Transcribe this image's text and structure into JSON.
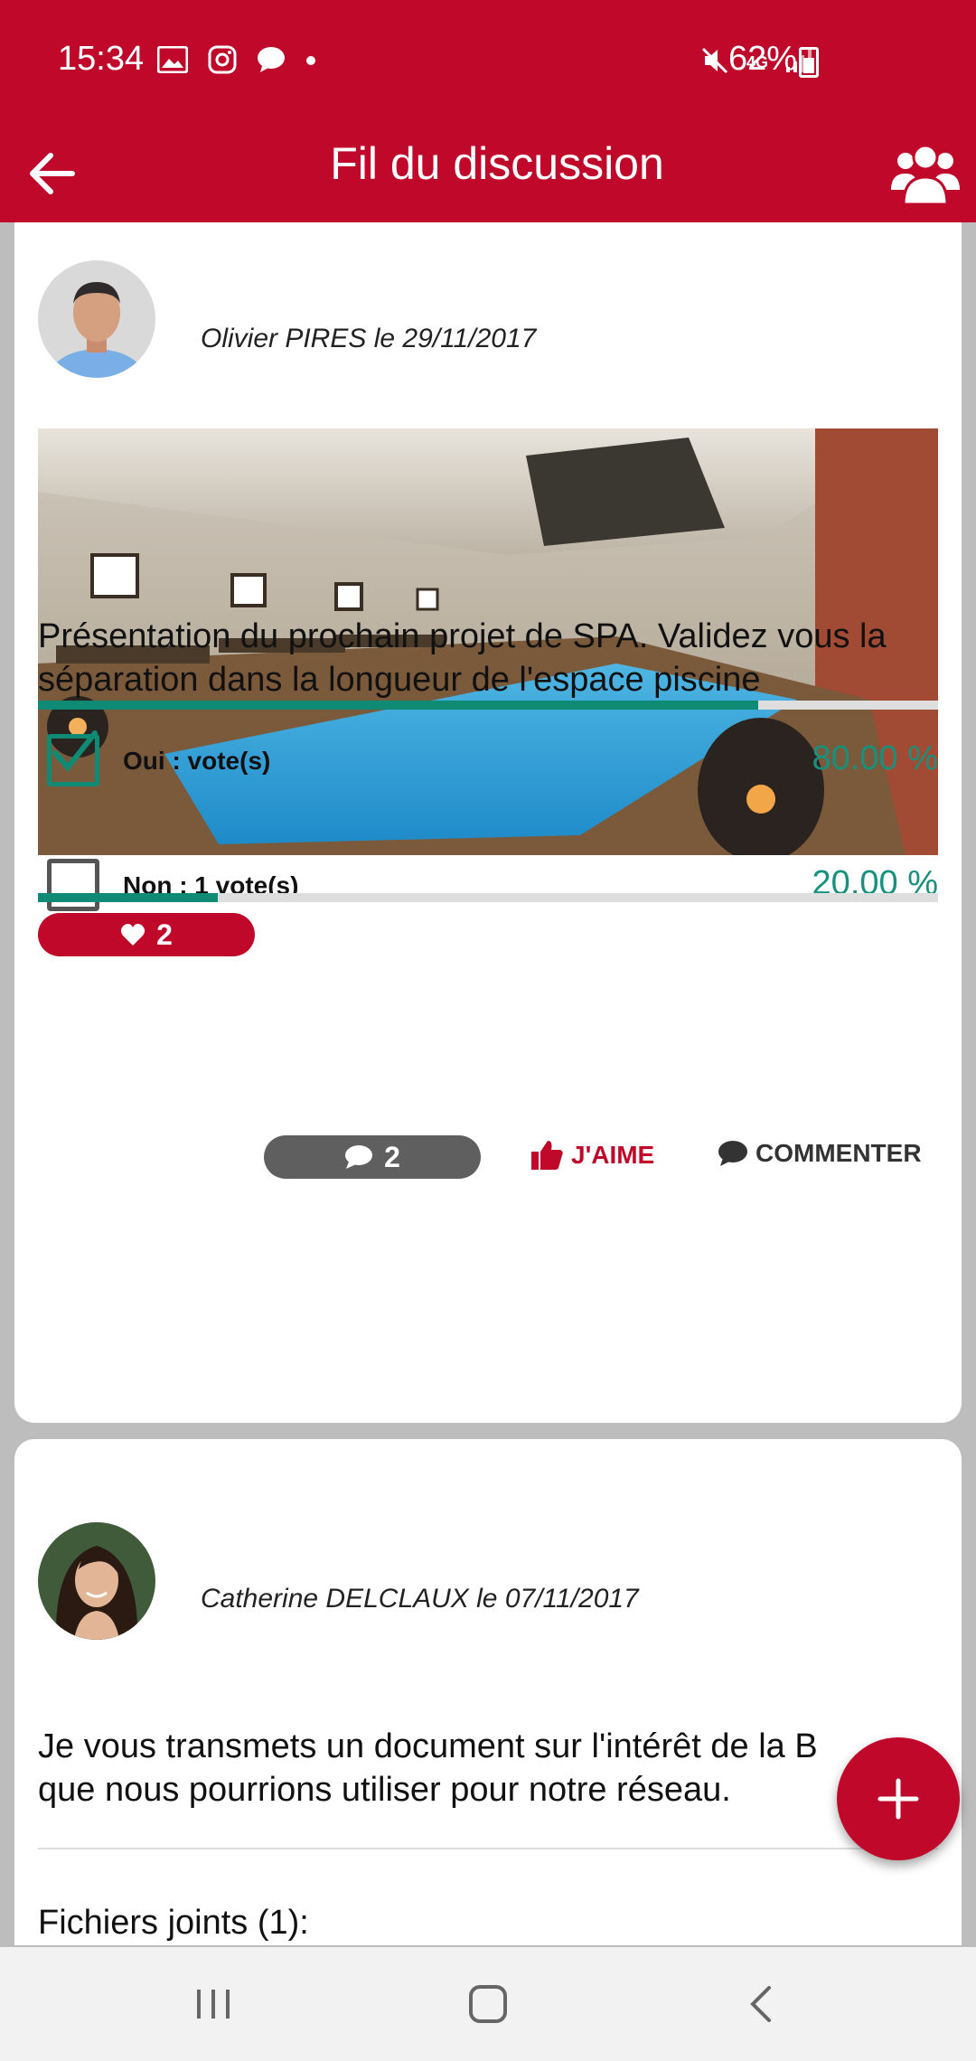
{
  "status_bar": {
    "time": "15:34",
    "network": "4G",
    "battery": "62%"
  },
  "app_bar": {
    "title": "Fil du discussion"
  },
  "posts": [
    {
      "author": "Olivier PIRES  le 29/11/2017",
      "text": "Présentation du prochain projet de SPA. Validez vous la séparation dans la longueur de l'espace piscine",
      "poll": [
        {
          "label": "Oui :  vote(s)",
          "percent_text": "80.00 %",
          "fraction": 0.8,
          "checked": true
        },
        {
          "label": "Non : 1 vote(s)",
          "percent_text": "20.00 %",
          "fraction": 0.2,
          "checked": false
        }
      ],
      "likes_count": "2",
      "comments_count": "2",
      "like_label": "J'AIME",
      "comment_label": "COMMENTER"
    },
    {
      "author": "Catherine DELCLAUX  le 07/11/2017",
      "text": "Je vous transmets un document sur l'intérêt de la B que nous pourrions utiliser pour notre réseau.",
      "attachments_label": "Fichiers joints (1):"
    }
  ],
  "colors": {
    "primary": "#c0092a",
    "accent": "#0f8b75"
  }
}
